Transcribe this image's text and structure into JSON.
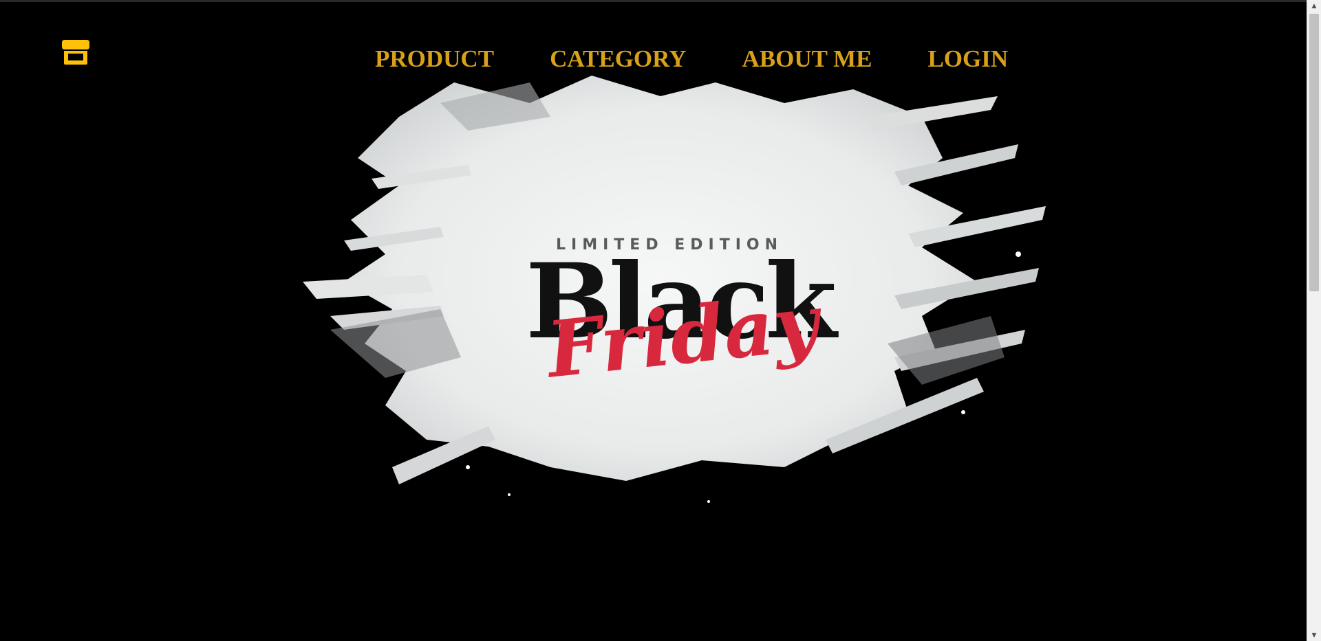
{
  "header": {
    "logo_icon": "store-icon",
    "logo_color": "#FFC107",
    "nav": [
      {
        "label": "PRODUCT"
      },
      {
        "label": "CATEGORY"
      },
      {
        "label": "ABOUT ME"
      },
      {
        "label": "LOGIN"
      }
    ],
    "nav_color": "#D9A11A"
  },
  "hero": {
    "tagline": "LIMITED EDITION",
    "headline_main": "Black",
    "headline_script": "Friday",
    "headline_script_color": "#D8283E",
    "background": "#000000"
  },
  "scrollbar": {
    "up_icon": "scroll-up-arrow-icon",
    "down_icon": "scroll-down-arrow-icon"
  }
}
